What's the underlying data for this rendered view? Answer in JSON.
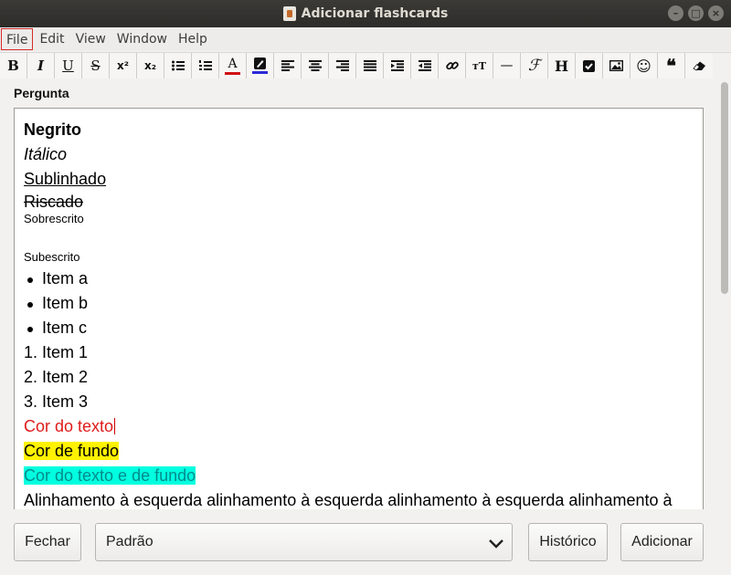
{
  "window": {
    "title": "Adicionar flashcards",
    "buttons": [
      "–",
      "□",
      "×"
    ]
  },
  "menubar": {
    "items": [
      "File",
      "Edit",
      "View",
      "Window",
      "Help"
    ],
    "active_index": 0
  },
  "toolbar": {
    "buttons": [
      {
        "name": "bold-button",
        "glyph": "B"
      },
      {
        "name": "italic-button",
        "glyph": "I"
      },
      {
        "name": "underline-button",
        "glyph": "U"
      },
      {
        "name": "strikethrough-button",
        "glyph": "S"
      },
      {
        "name": "superscript-button",
        "glyph": "x²"
      },
      {
        "name": "subscript-button",
        "glyph": "x₂"
      },
      {
        "name": "unordered-list-button",
        "icon": "bullet-list-icon"
      },
      {
        "name": "ordered-list-button",
        "icon": "numbered-list-icon"
      },
      {
        "name": "text-color-button",
        "glyph": "A",
        "color": "#d01010"
      },
      {
        "name": "highlight-color-button",
        "icon": "highlighter-icon",
        "color": "#2a2ad6"
      },
      {
        "name": "align-left-button",
        "icon": "align-left-icon"
      },
      {
        "name": "align-center-button",
        "icon": "align-center-icon"
      },
      {
        "name": "align-right-button",
        "icon": "align-right-icon"
      },
      {
        "name": "align-justify-button",
        "icon": "align-justify-icon"
      },
      {
        "name": "indent-button",
        "icon": "indent-icon"
      },
      {
        "name": "outdent-button",
        "icon": "outdent-icon"
      },
      {
        "name": "link-button",
        "icon": "link-icon"
      },
      {
        "name": "font-size-button",
        "glyph": "тT"
      },
      {
        "name": "horizontal-rule-button",
        "glyph": "—"
      },
      {
        "name": "math-button",
        "glyph": "ℱ"
      },
      {
        "name": "heading-button",
        "glyph": "H"
      },
      {
        "name": "checkbox-button",
        "icon": "check-square-icon"
      },
      {
        "name": "image-button",
        "icon": "image-icon"
      },
      {
        "name": "emoji-button",
        "glyph": "☺"
      },
      {
        "name": "blockquote-button",
        "glyph": "❝"
      },
      {
        "name": "clear-format-button",
        "icon": "eraser-icon"
      }
    ]
  },
  "editor": {
    "field_label": "Pergunta",
    "lines": {
      "bold": "Negrito",
      "italic": "Itálico",
      "underline": "Sublinhado",
      "strike": "Riscado",
      "superscript": "Sobrescrito",
      "subscript": "Subescrito",
      "bullets": [
        "Item a",
        "Item b",
        "Item c"
      ],
      "numbered": [
        "1. Item 1",
        "2. Item 2",
        "3. Item 3"
      ],
      "text_color": "Cor do texto",
      "background": "Cor de fundo",
      "both": "Cor do texto e de fundo",
      "align": "Alinhamento à esquerda alinhamento à esquerda alinhamento à esquerda alinhamento à"
    },
    "colors": {
      "text_red": "#e01b1b",
      "bg_yellow": "#fff200",
      "text_teal": "#008b8b",
      "bg_cyan": "#00ffe0"
    }
  },
  "bottom": {
    "close": "Fechar",
    "deck": "Padrão",
    "history": "Histórico",
    "add": "Adicionar"
  }
}
